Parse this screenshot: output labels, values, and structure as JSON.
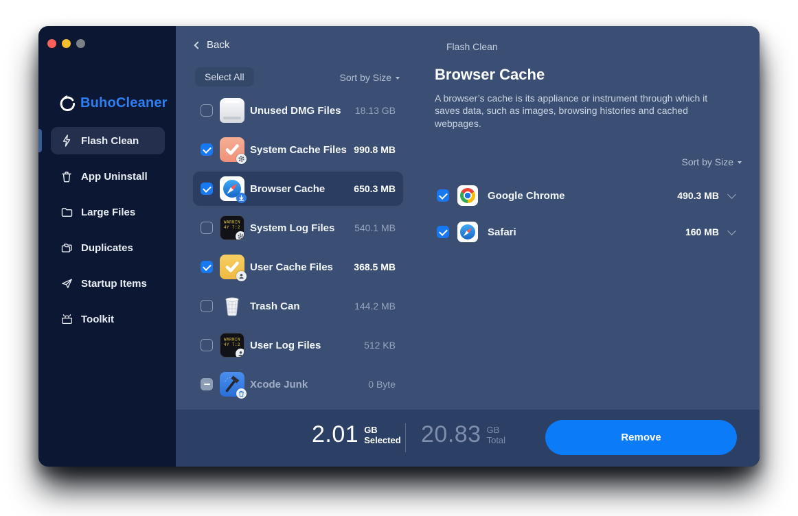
{
  "window": {
    "traffic_lights": [
      "red",
      "yellow",
      "gray"
    ]
  },
  "colors": {
    "accent_checkbox": "#1778f2",
    "remove_button": "#0c7bf7",
    "brand_text": "#2e7ff2",
    "panel": "#3a4f73",
    "sidebar": "#0c1833",
    "footer_bar": "#2c4066"
  },
  "sidebar": {
    "brand": "BuhoCleaner",
    "items": [
      {
        "label": "Flash Clean",
        "icon": "lightning-icon",
        "selected": true
      },
      {
        "label": "App Uninstall",
        "icon": "trash-icon",
        "selected": false
      },
      {
        "label": "Large Files",
        "icon": "folder-icon",
        "selected": false
      },
      {
        "label": "Duplicates",
        "icon": "duplicates-icon",
        "selected": false
      },
      {
        "label": "Startup Items",
        "icon": "rocket-icon",
        "selected": false
      },
      {
        "label": "Toolkit",
        "icon": "toolbox-icon",
        "selected": false
      }
    ]
  },
  "list_pane": {
    "back_label": "Back",
    "select_all_label": "Select All",
    "sort_label": "Sort by Size",
    "items": [
      {
        "name": "Unused DMG Files",
        "size": "18.13 GB",
        "checked": false,
        "icon": "dmg-icon"
      },
      {
        "name": "System Cache Files",
        "size": "990.8 MB",
        "checked": true,
        "icon": "system-cache-icon"
      },
      {
        "name": "Browser Cache",
        "size": "650.3 MB",
        "checked": true,
        "selected": true,
        "icon": "browser-cache-icon"
      },
      {
        "name": "System Log Files",
        "size": "540.1 MB",
        "checked": false,
        "icon": "system-log-icon"
      },
      {
        "name": "User Cache Files",
        "size": "368.5 MB",
        "checked": true,
        "icon": "user-cache-icon"
      },
      {
        "name": "Trash Can",
        "size": "144.2 MB",
        "checked": false,
        "icon": "trash-can-icon"
      },
      {
        "name": "User Log Files",
        "size": "512 KB",
        "checked": false,
        "icon": "user-log-icon"
      },
      {
        "name": "Xcode Junk",
        "size": "0 Byte",
        "checked": "indeterminate",
        "disabled": true,
        "icon": "xcode-junk-icon"
      }
    ]
  },
  "detail_pane": {
    "breadcrumb": "Flash Clean",
    "title": "Browser Cache",
    "description": "A browser’s cache is its appliance or instrument through which it saves data, such as images, browsing histories and cached webpages.",
    "sort_label": "Sort by Size",
    "items": [
      {
        "name": "Google Chrome",
        "size": "490.3 MB",
        "checked": true,
        "icon": "chrome-icon"
      },
      {
        "name": "Safari",
        "size": "160 MB",
        "checked": true,
        "icon": "safari-icon"
      }
    ]
  },
  "footer": {
    "selected_value": "2.01",
    "selected_unit": "GB",
    "selected_label": "Selected",
    "total_value": "20.83",
    "total_unit": "GB",
    "total_label": "Total",
    "remove_label": "Remove"
  }
}
